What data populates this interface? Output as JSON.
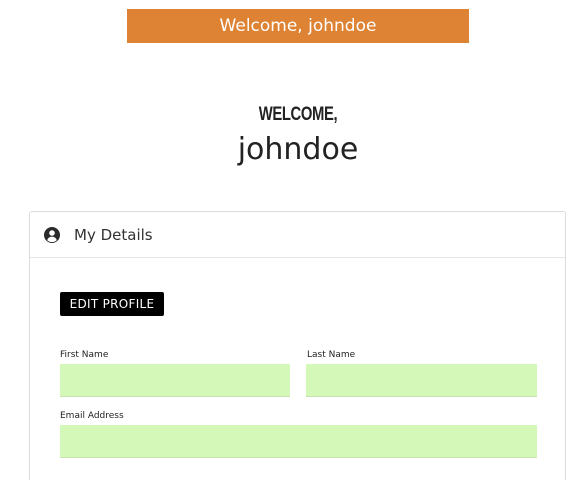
{
  "banner": {
    "text": "Welcome, johndoe"
  },
  "hero": {
    "welcome_label": "WELCOME,",
    "username": "johndoe"
  },
  "details_card": {
    "title": "My Details",
    "icon": "user-circle-icon",
    "edit_button_label": "EDIT PROFILE",
    "fields": {
      "first_name": {
        "label": "First Name",
        "value": "",
        "placeholder": ""
      },
      "last_name": {
        "label": "Last Name",
        "value": "",
        "placeholder": ""
      },
      "email": {
        "label": "Email Address",
        "value": "",
        "placeholder": ""
      }
    }
  },
  "colors": {
    "banner_bg": "#dd8333",
    "input_bg": "#d3f8b8",
    "button_bg": "#000000"
  }
}
